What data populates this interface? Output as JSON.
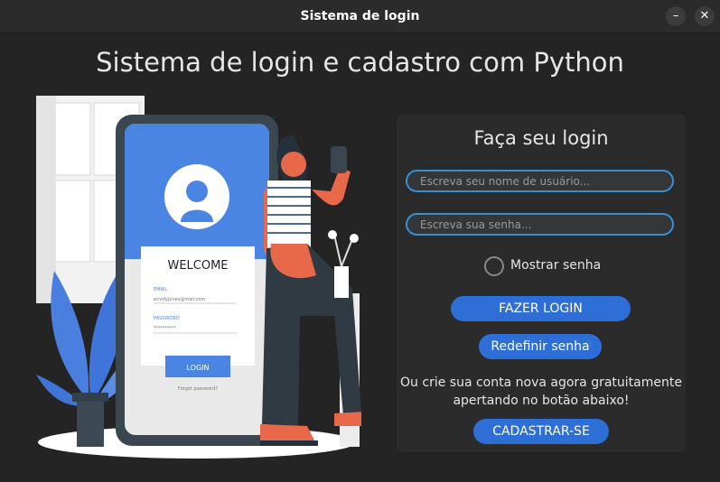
{
  "window": {
    "title": "Sistema de login",
    "minimize_icon": "minimize-icon",
    "close_icon": "close-icon",
    "minimize_glyph": "–",
    "close_glyph": "✕"
  },
  "heading": "Sistema de login e cadastro com Python",
  "illustration": {
    "welcome": "WELCOME",
    "email_label": "EMAIL",
    "email_value": "emrdyjones@mail.com",
    "password_label": "PASSWORD",
    "password_value": "**********",
    "login_button": "LOGIN",
    "forgot": "Forgot password?"
  },
  "login_panel": {
    "title": "Faça seu login",
    "username_placeholder": "Escreva seu nome de usuário...",
    "password_placeholder": "Escreva sua senha...",
    "show_password_label": "Mostrar senha",
    "show_password_checked": false,
    "login_button": "FAZER LOGIN",
    "reset_button": "Redefinir senha",
    "signup_note_line1": "Ou crie sua conta nova agora gratuitamente",
    "signup_note_line2": "apertando no botão abaixo!",
    "signup_button": "CADASTRAR-SE"
  },
  "colors": {
    "background": "#242424",
    "panel": "#2b2b2b",
    "accent": "#2d6fd6",
    "field_border": "#3b8ed0"
  }
}
